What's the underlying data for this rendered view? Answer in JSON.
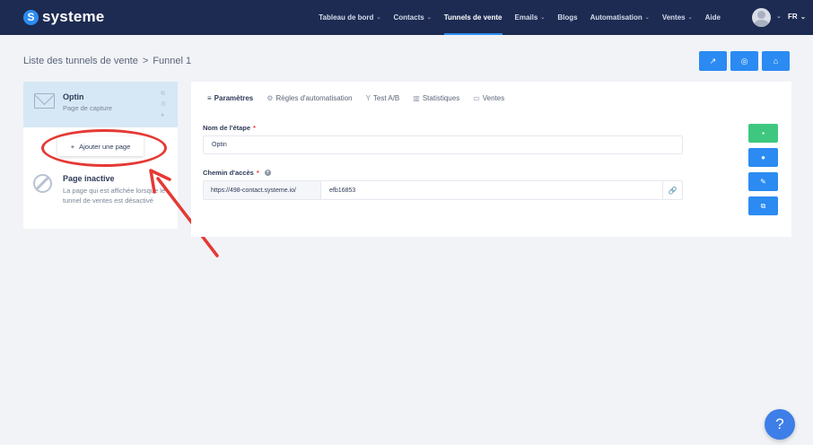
{
  "brand": {
    "name": "systeme",
    "badge": "S"
  },
  "nav": {
    "items": [
      {
        "label": "Tableau de bord",
        "caret": "⌄"
      },
      {
        "label": "Contacts",
        "caret": "⌄"
      },
      {
        "label": "Tunnels de vente",
        "caret": ""
      },
      {
        "label": "Emails",
        "caret": "⌄"
      },
      {
        "label": "Blogs",
        "caret": ""
      },
      {
        "label": "Automatisation",
        "caret": "⌄"
      },
      {
        "label": "Ventes",
        "caret": "⌄"
      },
      {
        "label": "Aide",
        "caret": ""
      }
    ],
    "active_index": 2,
    "lang": "FR",
    "lang_caret": "⌄",
    "avatar_caret": "⌄"
  },
  "breadcrumb": {
    "parent": "Liste des tunnels de vente",
    "separator": ">",
    "current": "Funnel 1"
  },
  "top_actions": {
    "open_icon": "↗",
    "settings_icon": "◎",
    "shop_icon": "⌂"
  },
  "steps": {
    "active": {
      "name": "Optin",
      "type": "Page de capture"
    },
    "add_page": {
      "plus": "+",
      "label": "Ajouter une page"
    },
    "inactive": {
      "title": "Page inactive",
      "description": "La page qui est affichée lorsque le tunnel de ventes est désactivé"
    }
  },
  "tabs": [
    {
      "icon": "≡",
      "label": "Paramètres",
      "active": true
    },
    {
      "icon": "⚙",
      "label": "Règles d'automatisation",
      "active": false
    },
    {
      "icon": "Y",
      "label": "Test A/B",
      "active": false
    },
    {
      "icon": "▥",
      "label": "Statistiques",
      "active": false
    },
    {
      "icon": "▭",
      "label": "Ventes",
      "active": false
    }
  ],
  "form": {
    "step_name_label": "Nom de l'étape",
    "step_name_value": "Optin",
    "path_label": "Chemin d'accès",
    "required_mark": "*",
    "help_mark": "?",
    "path_prefix": "https://498-contact.systeme.io/",
    "path_value": "efb16853",
    "link_icon": "🔗"
  },
  "side_actions": {
    "save_icon": "▪",
    "preview_icon": "●",
    "edit_icon": "✎",
    "copy_icon": "⧉"
  },
  "help_fab": "?",
  "colors": {
    "nav_bg": "#1d2b52",
    "accent": "#2b8bf2",
    "success": "#3ec87f",
    "annotation": "#e53935"
  }
}
